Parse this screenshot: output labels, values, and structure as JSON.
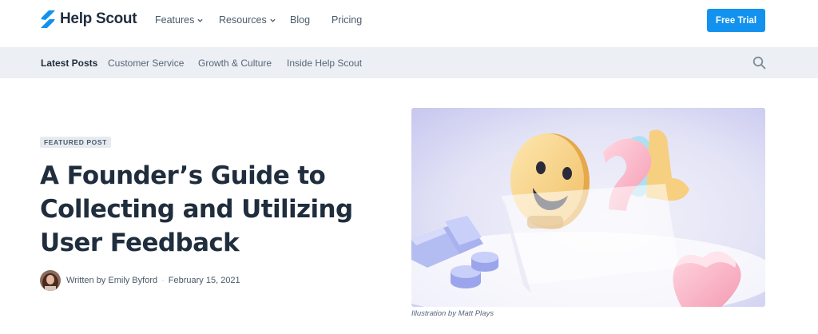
{
  "header": {
    "logo_text": "Help Scout",
    "nav": [
      {
        "label": "Features",
        "has_dropdown": true
      },
      {
        "label": "Resources",
        "has_dropdown": true
      },
      {
        "label": "Blog",
        "has_dropdown": false
      },
      {
        "label": "Pricing",
        "has_dropdown": false
      }
    ],
    "cta_label": "Free Trial",
    "accent_color": "#1292ee"
  },
  "subnav": {
    "items": [
      {
        "label": "Latest Posts",
        "active": true
      },
      {
        "label": "Customer Service",
        "active": false
      },
      {
        "label": "Growth & Culture",
        "active": false
      },
      {
        "label": "Inside Help Scout",
        "active": false
      }
    ],
    "search_icon": "search-icon"
  },
  "featured": {
    "badge": "FEATURED POST",
    "title": "A Founder’s Guide to Collecting and Utilizing User Feedback",
    "byline": "Written by Emily Byford",
    "date": "February 15, 2021",
    "image_caption": "Illustration by Matt Plays"
  }
}
